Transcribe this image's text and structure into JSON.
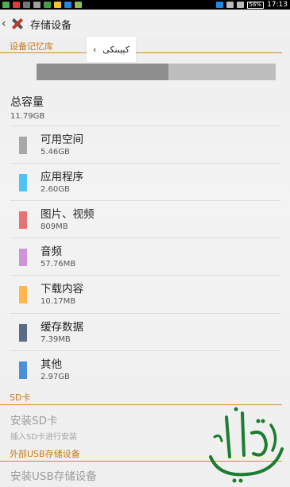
{
  "status_bar": {
    "battery": "56%",
    "time": "17:13"
  },
  "action_bar": {
    "title": "存储设备"
  },
  "device_storage": {
    "header": "设备记忆库",
    "tooltip_text": "كېيىنكى",
    "used_fraction": 0.55,
    "total_label": "总容量",
    "total_value": "11.79GB",
    "items": [
      {
        "label": "可用空间",
        "value": "5.46GB",
        "color": "#a8a8a8"
      },
      {
        "label": "应用程序",
        "value": "2.60GB",
        "color": "#4fc3f7"
      },
      {
        "label": "图片、视频",
        "value": "809MB",
        "color": "#e57373"
      },
      {
        "label": "音频",
        "value": "57.76MB",
        "color": "#ce93d8"
      },
      {
        "label": "下载内容",
        "value": "10.17MB",
        "color": "#ffb74d"
      },
      {
        "label": "缓存数据",
        "value": "7.39MB",
        "color": "#5c6a85"
      },
      {
        "label": "其他",
        "value": "2.97GB",
        "color": "#4a90d9"
      }
    ]
  },
  "sd_card": {
    "header": "SD卡",
    "install_title": "安装SD卡",
    "install_sub": "插入SD卡进行安装"
  },
  "usb_storage": {
    "header": "外部USB存储设备",
    "install_title": "安装USB存储设备"
  },
  "watermark_text": "ئالتۇنى"
}
